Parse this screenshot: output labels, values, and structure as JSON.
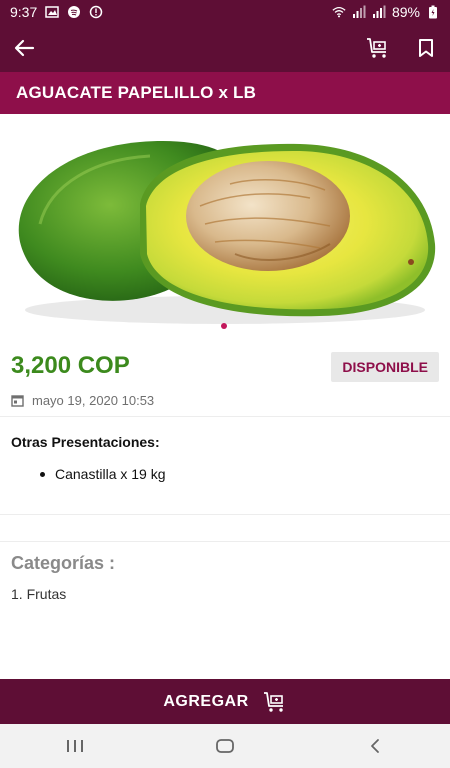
{
  "status": {
    "time": "9:37",
    "battery": "89%"
  },
  "product": {
    "title": "AGUACATE PAPELILLO x LB",
    "price": "3,200 COP",
    "availability": "DISPONIBLE",
    "date": "mayo 19, 2020 10:53"
  },
  "presentations": {
    "heading": "Otras Presentaciones:",
    "items": [
      "Canastilla x 19 kg"
    ]
  },
  "categories": {
    "heading": "Categorías :",
    "items": [
      "1. Frutas"
    ]
  },
  "actions": {
    "add_label": "AGREGAR"
  },
  "colors": {
    "primary": "#5e0e35",
    "title_band": "#8e0f4a",
    "price": "#3c8a1d",
    "badge_bg": "#e8e8e8"
  },
  "icons": {
    "back": "arrow-left-icon",
    "cart": "cart-icon",
    "bookmark": "bookmark-icon",
    "calendar": "calendar-icon"
  }
}
